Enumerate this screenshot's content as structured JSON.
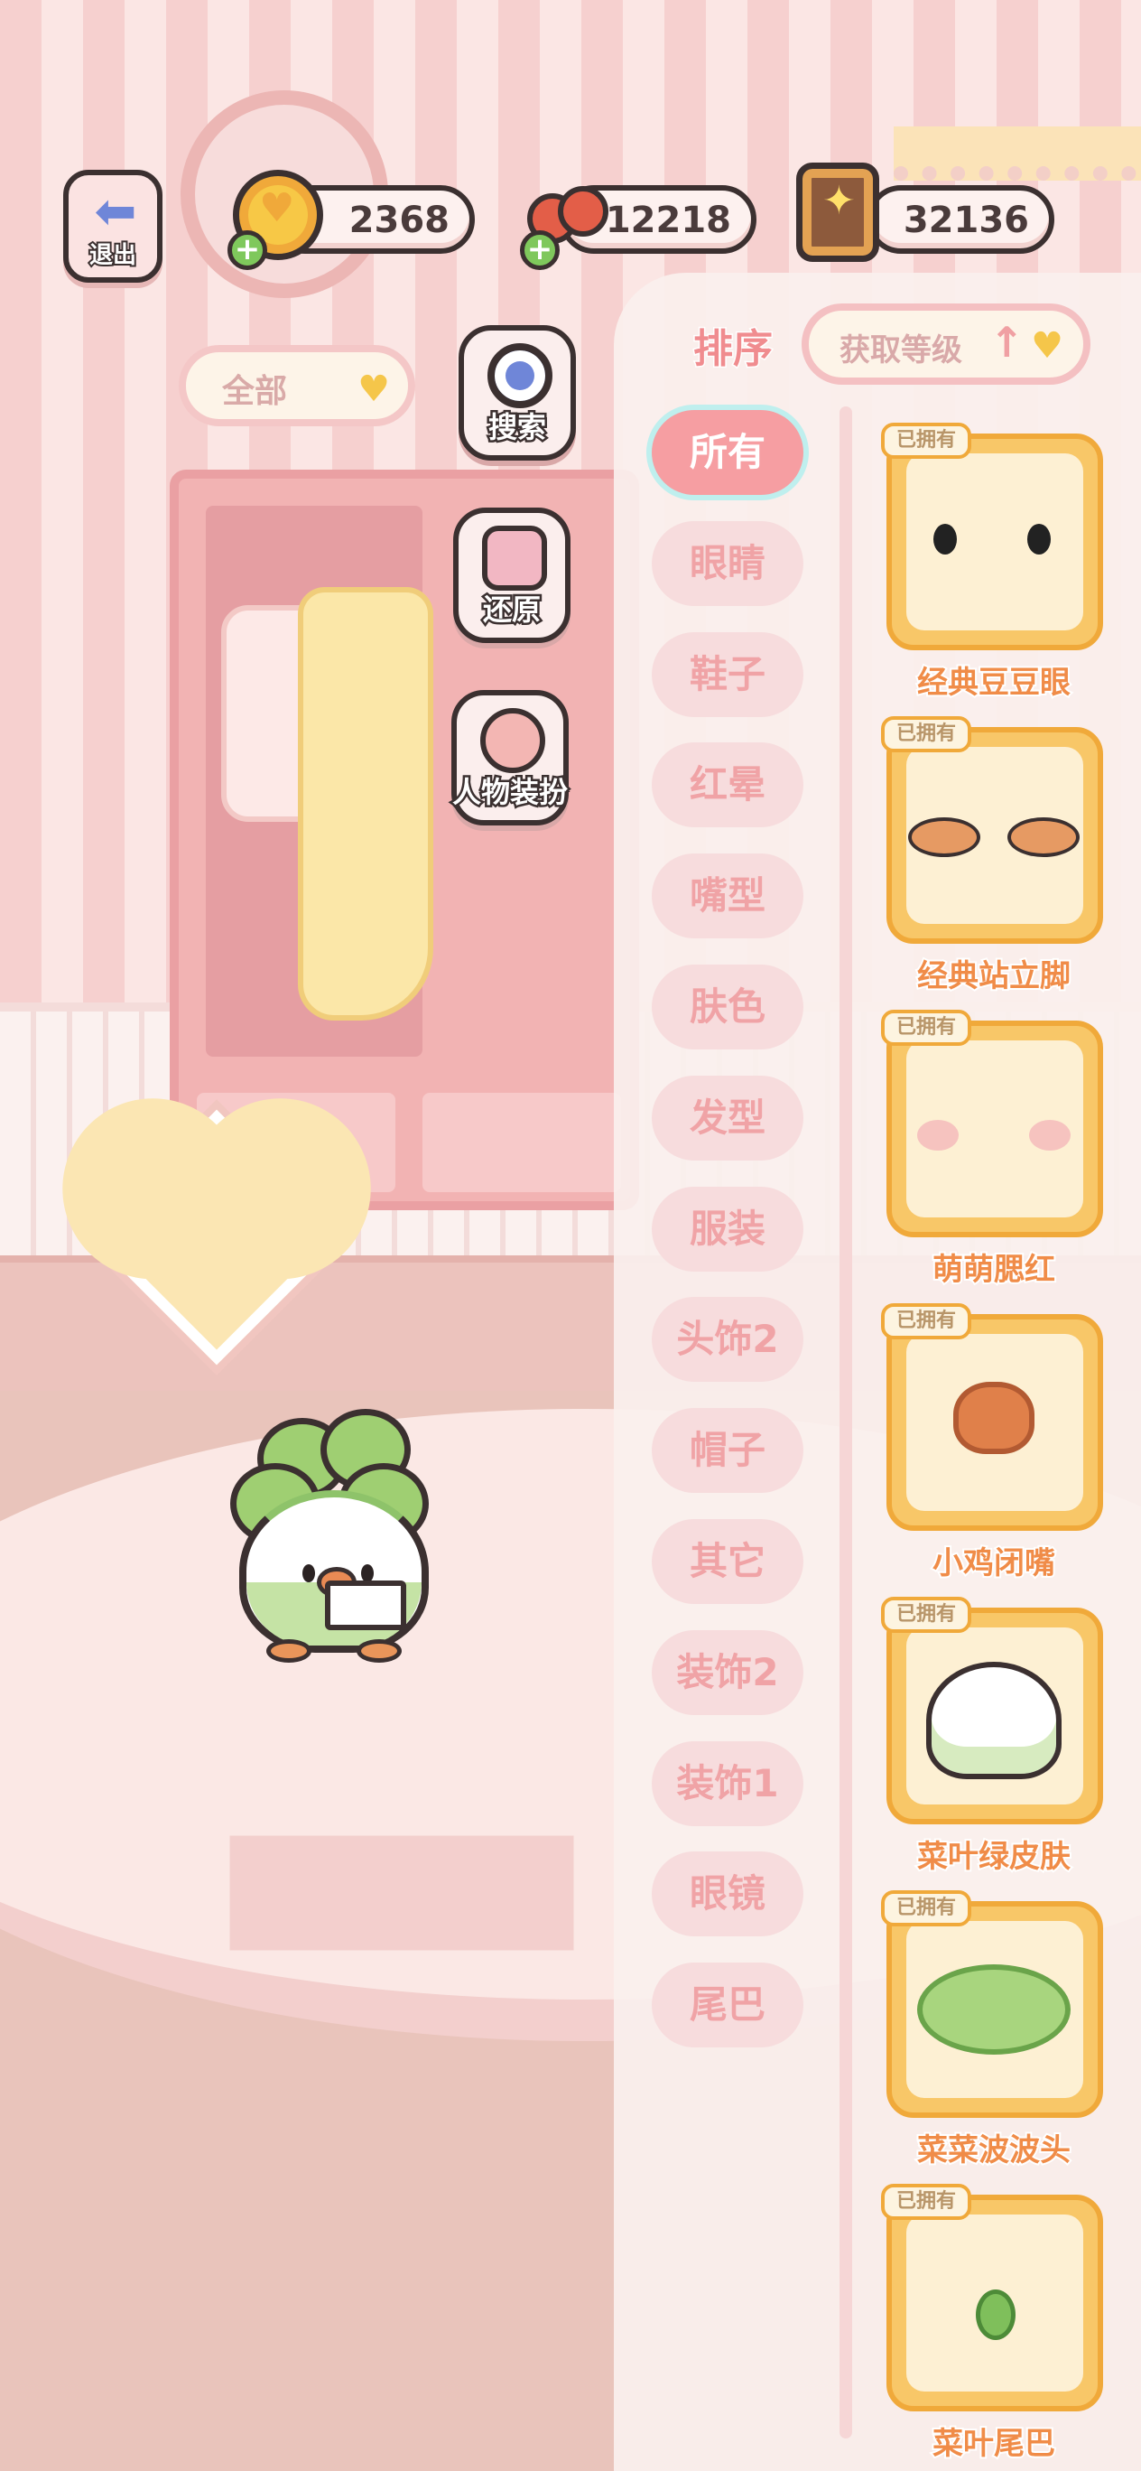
{
  "topbar": {
    "exit_label": "退出",
    "coins": "2368",
    "cherries": "12218",
    "books": "32136",
    "icons": {
      "exit": "back-arrow-icon",
      "coins": "heart-coin-icon",
      "cherries": "cherry-icon",
      "books": "book-icon",
      "add": "plus-icon"
    }
  },
  "filter": {
    "label": "全部",
    "icon": "heart-icon"
  },
  "tools": [
    {
      "label": "搜索",
      "icon": "magnifier-icon"
    },
    {
      "label": "还原",
      "icon": "clothes-icon"
    },
    {
      "label": "人物装扮",
      "icon": "girl-avatar-icon"
    }
  ],
  "sort": {
    "title": "排序",
    "option": "获取等级",
    "direction_icon": "arrow-up-icon"
  },
  "categories": [
    "所有",
    "眼睛",
    "鞋子",
    "红晕",
    "嘴型",
    "肤色",
    "发型",
    "服装",
    "头饰2",
    "帽子",
    "其它",
    "装饰2",
    "装饰1",
    "眼镜",
    "尾巴"
  ],
  "active_category": "所有",
  "owned_badge": "已拥有",
  "items": [
    {
      "name": "经典豆豆眼",
      "icon": "bean-eyes-icon"
    },
    {
      "name": "经典站立脚",
      "icon": "standing-feet-icon"
    },
    {
      "name": "萌萌腮红",
      "icon": "blush-icon"
    },
    {
      "name": "小鸡闭嘴",
      "icon": "chick-beak-icon"
    },
    {
      "name": "菜叶绿皮肤",
      "icon": "white-skin-icon"
    },
    {
      "name": "菜菜波波头",
      "icon": "lettuce-hair-icon"
    },
    {
      "name": "菜叶尾巴",
      "icon": "leaf-tail-icon"
    }
  ],
  "colors": {
    "accent_pink": "#f69ea2",
    "gold": "#f8c768",
    "orange_text": "#f08c48"
  }
}
